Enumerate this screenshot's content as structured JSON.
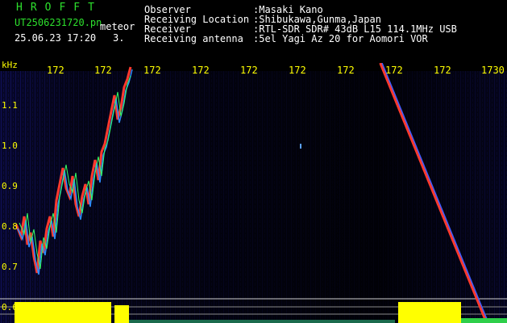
{
  "header": {
    "app_title": "HROFFT",
    "filename": "UT2506231720.pn",
    "mode": "meteor",
    "timestamp": "25.06.23 17:20",
    "count": "3.",
    "fields": [
      {
        "label": "Observer",
        "value": ":Masaki Kano"
      },
      {
        "label": "Receiving Location",
        "value": ":Shibukawa,Gunma,Japan"
      },
      {
        "label": "Receiver",
        "value": ":RTL-SDR SDR# 43dB L15 114.1MHz USB"
      },
      {
        "label": "Receiving antenna",
        "value": ":5el Yagi Az 20 for Aomori VOR"
      }
    ]
  },
  "x_axis": {
    "ticks": [
      "172",
      "172",
      "172",
      "172",
      "172",
      "172",
      "172",
      "172",
      "172",
      "1730"
    ]
  },
  "y_axis": {
    "unit": "kHz",
    "ticks": [
      "1.1",
      "1.0",
      "0.9",
      "0.8",
      "0.7",
      "0.6"
    ]
  },
  "colors": {
    "background": "#000000",
    "text_header": "#ffffff",
    "text_title": "#2de02d",
    "axis_text": "#ffff00",
    "signal_level": "#ffff00"
  }
}
